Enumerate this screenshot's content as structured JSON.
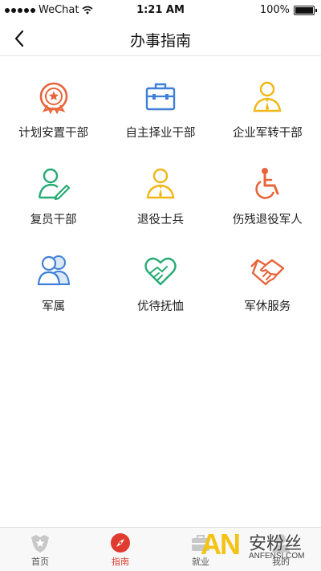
{
  "status_bar": {
    "carrier": "WeChat",
    "time": "1:21 AM",
    "battery": "100%",
    "battery_level": 1.0
  },
  "nav": {
    "title": "办事指南",
    "back_icon": "chevron-left-icon"
  },
  "grid": {
    "items": [
      {
        "label": "计划安置干部",
        "icon": "badge-star-icon",
        "color": "#e8643a"
      },
      {
        "label": "自主择业干部",
        "icon": "briefcase-icon",
        "color": "#3f7fd6"
      },
      {
        "label": "企业军转干部",
        "icon": "person-tie-icon",
        "color": "#f1b716"
      },
      {
        "label": "复员干部",
        "icon": "person-edit-icon",
        "color": "#27ab74"
      },
      {
        "label": "退役士兵",
        "icon": "person-tie-icon",
        "color": "#f1b716"
      },
      {
        "label": "伤残退役军人",
        "icon": "wheelchair-icon",
        "color": "#e8643a"
      },
      {
        "label": "军属",
        "icon": "family-icon",
        "color": "#3f7fd6"
      },
      {
        "label": "优待抚恤",
        "icon": "heart-hands-icon",
        "color": "#27ab74"
      },
      {
        "label": "军休服务",
        "icon": "handshake-icon",
        "color": "#e8643a"
      }
    ]
  },
  "tabs": [
    {
      "label": "首页",
      "icon": "home-badge-icon",
      "active": false
    },
    {
      "label": "指南",
      "icon": "compass-icon",
      "active": true
    },
    {
      "label": "就业",
      "icon": "briefcase-icon",
      "active": false
    },
    {
      "label": "我的",
      "icon": "person-icon",
      "active": false
    }
  ],
  "colors": {
    "accent": "#e03b2f",
    "tab_inactive": "#c8c8c8"
  },
  "watermark": {
    "brand": "AN",
    "text": "安粉丝",
    "url": "ANFENSI.COM"
  }
}
